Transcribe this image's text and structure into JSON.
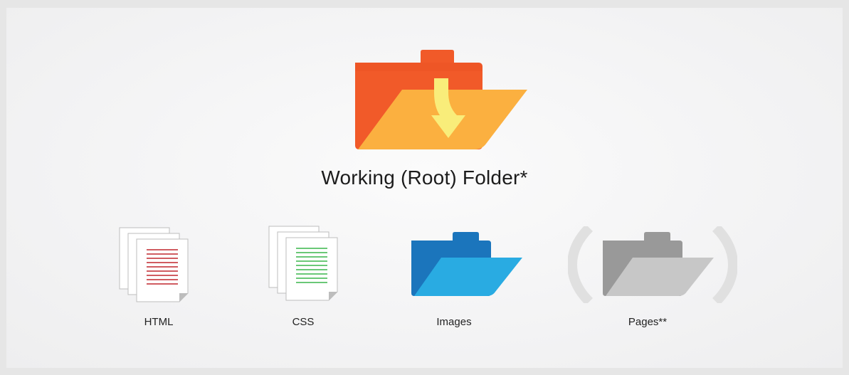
{
  "root": {
    "label": "Working (Root) Folder*",
    "icon": "open-folder-icon"
  },
  "items": [
    {
      "label": "HTML",
      "icon": "document-stack-icon"
    },
    {
      "label": "CSS",
      "icon": "document-stack-icon"
    },
    {
      "label": "Images",
      "icon": "open-folder-icon"
    },
    {
      "label": "Pages**",
      "icon": "open-folder-icon"
    }
  ],
  "colors": {
    "root_folder_back": "#f15a29",
    "root_folder_front": "#fbb040",
    "root_arrow": "#f9ed7a",
    "html_lines": "#c1272d",
    "css_lines": "#39b54a",
    "images_folder_back": "#1b75bc",
    "images_folder_front": "#29abe2",
    "pages_folder_back": "#999999",
    "pages_folder_front": "#c7c7c7",
    "pages_parens": "#e0e0e0"
  }
}
